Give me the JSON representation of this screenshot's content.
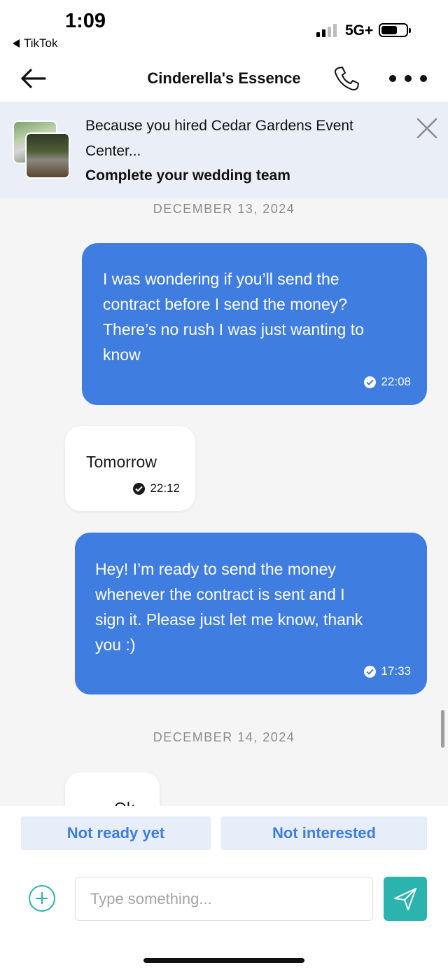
{
  "status_bar": {
    "time": "1:09",
    "back_app": "TikTok",
    "network": "5G+"
  },
  "header": {
    "title": "Cinderella's Essence"
  },
  "banner": {
    "line1": "Because you hired Cedar Gardens Event",
    "line2": "Center...",
    "line3": "Complete your wedding team"
  },
  "messages": {
    "date1": "DECEMBER 13, 2024",
    "m1": {
      "lines": [
        "I was wondering if you’ll send the",
        "contract before I send the money?",
        "There’s no rush I was just wanting to",
        "know"
      ],
      "time": "22:08"
    },
    "m2": {
      "text": "Tomorrow",
      "time": "22:12"
    },
    "m3": {
      "lines": [
        "Hey! I’m ready to send the money",
        "whenever the contract is sent and I",
        "sign it. Please just let me know, thank",
        "you :)"
      ],
      "time": "17:33"
    },
    "date2": "DECEMBER 14, 2024",
    "m4": {
      "text": "Ok"
    }
  },
  "quick_replies": {
    "q1": "Not ready yet",
    "q2": "Not interested"
  },
  "composer": {
    "placeholder": "Type something..."
  },
  "colors": {
    "accent_blue": "#3f7de0",
    "teal": "#2bb3ae",
    "banner_bg": "#e9eef7"
  }
}
